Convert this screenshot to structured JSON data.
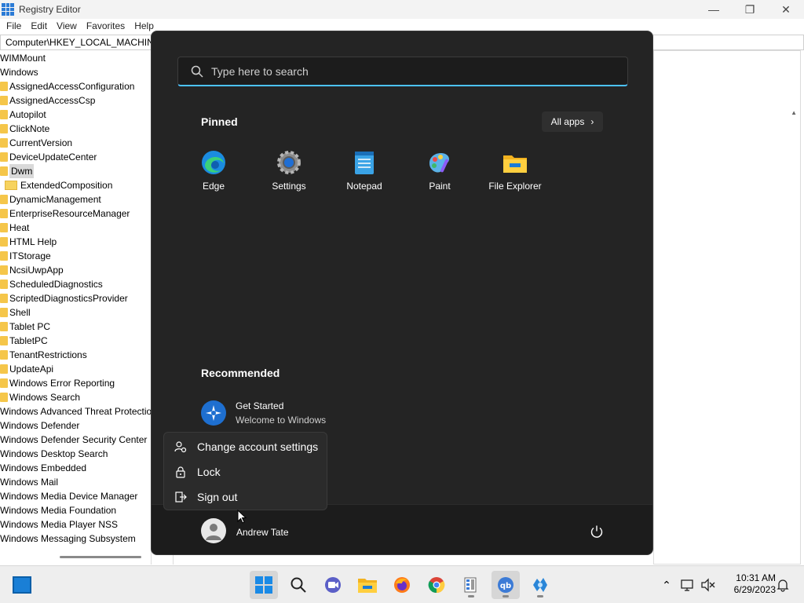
{
  "registry": {
    "title": "Registry Editor",
    "menu": [
      "File",
      "Edit",
      "View",
      "Favorites",
      "Help"
    ],
    "address": "Computer\\HKEY_LOCAL_MACHINE",
    "tree": [
      {
        "label": "WIMMount",
        "folder": false
      },
      {
        "label": "Windows",
        "folder": false
      },
      {
        "label": "AssignedAccessConfiguration",
        "folder": true
      },
      {
        "label": "AssignedAccessCsp",
        "folder": true
      },
      {
        "label": "Autopilot",
        "folder": true
      },
      {
        "label": "ClickNote",
        "folder": true
      },
      {
        "label": "CurrentVersion",
        "folder": true
      },
      {
        "label": "DeviceUpdateCenter",
        "folder": true
      },
      {
        "label": "Dwm",
        "folder": true,
        "selected": true
      },
      {
        "label": "ExtendedComposition",
        "folder": "open"
      },
      {
        "label": "DynamicManagement",
        "folder": true
      },
      {
        "label": "EnterpriseResourceManager",
        "folder": true
      },
      {
        "label": "Heat",
        "folder": true
      },
      {
        "label": "HTML Help",
        "folder": true
      },
      {
        "label": "ITStorage",
        "folder": true
      },
      {
        "label": "NcsiUwpApp",
        "folder": true
      },
      {
        "label": "ScheduledDiagnostics",
        "folder": true
      },
      {
        "label": "ScriptedDiagnosticsProvider",
        "folder": true
      },
      {
        "label": "Shell",
        "folder": true
      },
      {
        "label": "Tablet PC",
        "folder": true
      },
      {
        "label": "TabletPC",
        "folder": true
      },
      {
        "label": "TenantRestrictions",
        "folder": true
      },
      {
        "label": "UpdateApi",
        "folder": true
      },
      {
        "label": "Windows Error Reporting",
        "folder": true
      },
      {
        "label": "Windows Search",
        "folder": true
      },
      {
        "label": "Windows Advanced Threat Protection",
        "folder": false
      },
      {
        "label": "Windows Defender",
        "folder": false
      },
      {
        "label": "Windows Defender Security Center",
        "folder": false
      },
      {
        "label": "Windows Desktop Search",
        "folder": false
      },
      {
        "label": "Windows Embedded",
        "folder": false
      },
      {
        "label": "Windows Mail",
        "folder": false
      },
      {
        "label": "Windows Media Device Manager",
        "folder": false
      },
      {
        "label": "Windows Media Foundation",
        "folder": false
      },
      {
        "label": "Windows Media Player NSS",
        "folder": false
      },
      {
        "label": "Windows Messaging Subsystem",
        "folder": false
      }
    ]
  },
  "start_menu": {
    "search_placeholder": "Type here to search",
    "pinned_title": "Pinned",
    "all_apps_label": "All apps",
    "pinned_apps": [
      {
        "label": "Edge",
        "icon": "edge-icon"
      },
      {
        "label": "Settings",
        "icon": "settings-icon"
      },
      {
        "label": "Notepad",
        "icon": "notepad-icon"
      },
      {
        "label": "Paint",
        "icon": "paint-icon"
      },
      {
        "label": "File Explorer",
        "icon": "file-explorer-icon"
      }
    ],
    "recommended_title": "Recommended",
    "recommended": [
      {
        "title": "Get Started",
        "subtitle": "Welcome to Windows",
        "icon": "get-started-icon"
      }
    ],
    "user_name": "Andrew Tate",
    "account_menu": [
      {
        "label": "Change account settings",
        "icon": "account-settings-icon"
      },
      {
        "label": "Lock",
        "icon": "lock-icon"
      },
      {
        "label": "Sign out",
        "icon": "sign-out-icon"
      }
    ]
  },
  "taskbar": {
    "time": "10:31 AM",
    "date": "6/29/2023"
  },
  "colors": {
    "accent": "#4cc2ff",
    "start_bg": "#242424",
    "taskbar_bg": "#eeeeee"
  }
}
